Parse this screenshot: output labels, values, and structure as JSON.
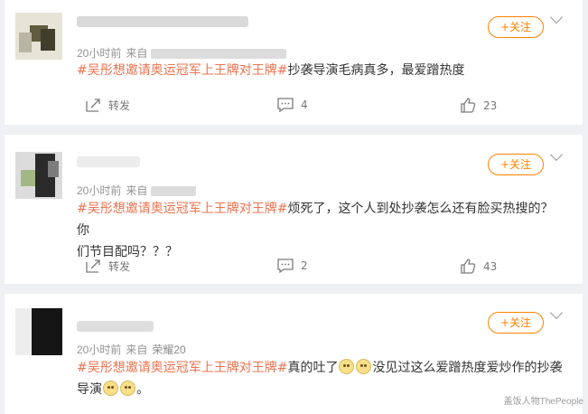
{
  "posts": [
    {
      "time": "20小时前",
      "from": "来自",
      "source": "",
      "hashtag": "#吴彤想邀请奥运冠军上王牌对王牌#",
      "text": "抄袭导演毛病真多，最爱蹭热度",
      "text2": "",
      "follow": "+关注",
      "repost": "转发",
      "comments": "4",
      "likes": "23"
    },
    {
      "time": "20小时前",
      "from": "来自",
      "source": "",
      "hashtag": "#吴彤想邀请奥运冠军上王牌对王牌#",
      "text": "烦死了，这个人到处抄袭怎么还有脸买热搜的？你",
      "text2": "们节目配吗？？？",
      "follow": "+关注",
      "repost": "转发",
      "comments": "2",
      "likes": "43"
    },
    {
      "time": "20小时前",
      "from": "来自",
      "source": "荣耀20",
      "hashtag": "#吴彤想邀请奥运冠军上王牌对王牌#",
      "text": "真的吐了",
      "text_after_emoji": "没见过这么爱蹭热度爱炒作的抄袭",
      "text2": "导演",
      "text2_end": "。",
      "follow": "+关注"
    }
  ],
  "watermark": "盖饭人物ThePeople",
  "colors": {
    "hashtag": "#eb7350",
    "follow": "#ff8200",
    "background": "#eef0f3"
  },
  "icons": [
    "chevron-down-icon",
    "share-icon",
    "comment-icon",
    "like-icon",
    "smile-emoji-icon"
  ]
}
